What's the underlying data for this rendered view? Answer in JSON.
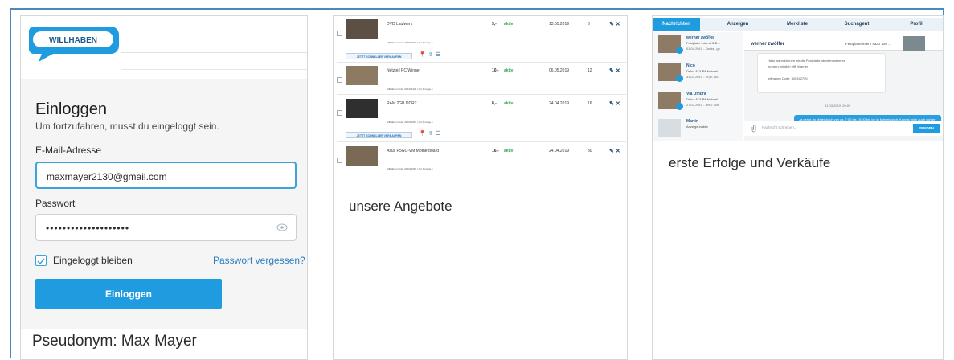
{
  "login": {
    "brand": "WILLHABEN",
    "title": "Einloggen",
    "subtitle": "Um fortzufahren, musst du eingeloggt sein.",
    "email_label": "E-Mail-Adresse",
    "email_value": "maxmayer2130@gmail.com",
    "password_label": "Passwort",
    "password_value": "••••••••••••••••••••",
    "remember_label": "Eingeloggt bleiben",
    "forgot_label": "Passwort vergessen?",
    "login_button": "Einloggen",
    "caption": "Pseudonym: Max Mayer"
  },
  "listings": {
    "caption": "unsere Angebote",
    "sell_faster": "JETZT SCHNELLER VERKAUFEN",
    "items": [
      {
        "name": "DVD Laufwerk",
        "price": "3,-",
        "status": "aktiv",
        "date": "13.05.2019",
        "views": "6",
        "code": "willhaben Code: 302977731 | zur Anzeige >"
      },
      {
        "name": "Netzteil PC Winner",
        "price": "10,-",
        "status": "aktiv",
        "date": "06.05.2019",
        "views": "12",
        "code": "willhaben Code: 302479420 | zur Anzeige >"
      },
      {
        "name": "RAM 2GB DDR2",
        "price": "8,-",
        "status": "aktiv",
        "date": "24.04.2019",
        "views": "16",
        "code": "willhaben Code: 300342051 | zur Anzeige >"
      },
      {
        "name": "Asus P5GC-VM Motherboard",
        "price": "16,-",
        "status": "aktiv",
        "date": "24.04.2019",
        "views": "30",
        "code": "willhaben Code: 300342053 | zur Anzeige >"
      }
    ]
  },
  "messages": {
    "caption": "erste Erfolge und Verkäufe",
    "tabs": [
      "Nachrichten",
      "Anzeigen",
      "Merkliste",
      "Suchagent",
      "Profil"
    ],
    "conversations": [
      {
        "name": "werner zwölfer",
        "line1": "Festplatte intern HDD...",
        "line2": "01.04.2019 - Danke, ge"
      },
      {
        "name": "Nico",
        "line1": "Delux ATX PA Netzteil ...",
        "line2": "31.03.2019 - Hi ja, fuß"
      },
      {
        "name": "Via Umbra",
        "line1": "Delux ATX PA Netzteil ...",
        "line2": "27.03.2019 - hvr 2 sola"
      },
      {
        "name": "Martin",
        "line1": "Anzeige inaktiv",
        "line2": ""
      }
    ],
    "chat_title": "werner zwölfer",
    "chat_product": "Festplatte intern HDD 320 ...",
    "msg_in_1": "Hallo wann können wir die Festplatte abholen wenn es",
    "msg_in_2": "morgen möglich trifft Warner",
    "msg_in_code": "willhaben Code: 300342755",
    "chat_date": "31.03.2019, 20:09",
    "msg_out": "Ja gerne, in Metelsbach von ca. 7:00 bis 15:00 bin ich in Meiselsbach. Kannst mich auch vorher anrufen: 066475069010",
    "input_placeholder": "Nachricht schreiben...",
    "send_button": "SENDEN"
  }
}
